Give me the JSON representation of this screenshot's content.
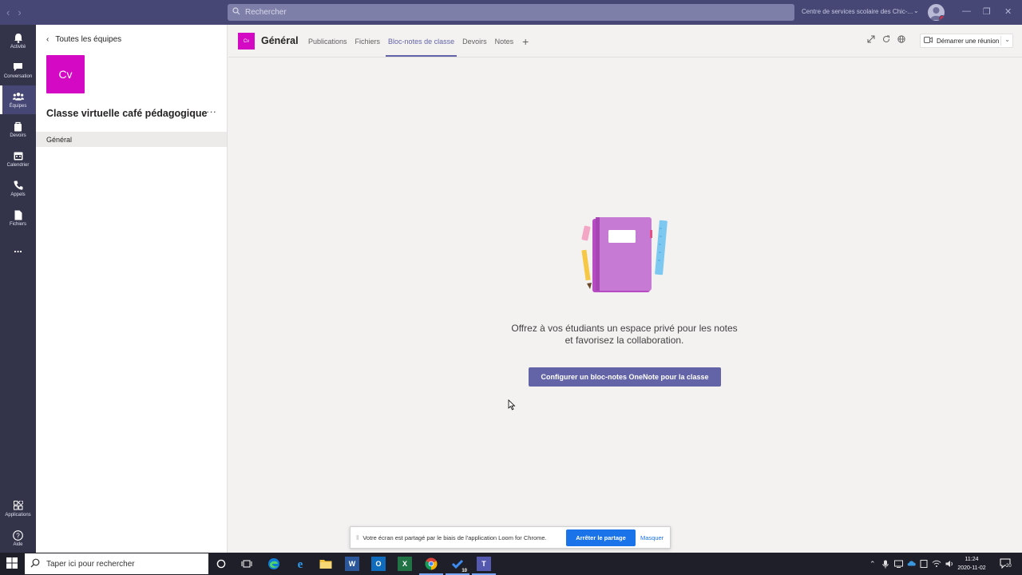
{
  "titlebar": {
    "search_placeholder": "Rechercher",
    "tenant": "Centre de services scolaire des Chic-..."
  },
  "rail": {
    "items": [
      {
        "label": "Activité",
        "icon": "bell-icon"
      },
      {
        "label": "Conversation",
        "icon": "chat-icon"
      },
      {
        "label": "Équipes",
        "icon": "teams-icon"
      },
      {
        "label": "Devoirs",
        "icon": "assignments-icon"
      },
      {
        "label": "Calendrier",
        "icon": "calendar-icon"
      },
      {
        "label": "Appels",
        "icon": "phone-icon"
      },
      {
        "label": "Fichiers",
        "icon": "files-icon"
      }
    ],
    "more": "...",
    "bottom": [
      {
        "label": "Applications",
        "icon": "apps-icon"
      },
      {
        "label": "Aide",
        "icon": "help-icon"
      }
    ]
  },
  "leftpane": {
    "back_label": "Toutes les équipes",
    "team_initials": "Cv",
    "team_name": "Classe virtuelle café pédagogique",
    "more": "···",
    "channel": "Général"
  },
  "header": {
    "tile_initials": "Cv",
    "channel_title": "Général",
    "tabs": [
      "Publications",
      "Fichiers",
      "Bloc-notes de classe",
      "Devoirs",
      "Notes"
    ],
    "active_tab": "Bloc-notes de classe",
    "add_tab": "+",
    "meet_button": "Démarrer une réunion"
  },
  "content": {
    "line1": "Offrez à vos étudiants un espace privé pour les notes",
    "line2": "et favorisez la collaboration.",
    "cta": "Configurer un bloc-notes OneNote pour la classe"
  },
  "sharebar": {
    "message": "Votre écran est partagé par le biais de l'application Loom for Chrome.",
    "stop": "Arrêter le partage",
    "hide": "Masquer"
  },
  "taskbar": {
    "search_placeholder": "Taper ici pour rechercher",
    "time": "11:24",
    "date": "2020-11-02",
    "notifications": "20",
    "badge": "10"
  },
  "colors": {
    "titlebar": "#464775",
    "rail": "#33344a",
    "accent": "#6264a7",
    "team_tile": "#d309c4"
  }
}
